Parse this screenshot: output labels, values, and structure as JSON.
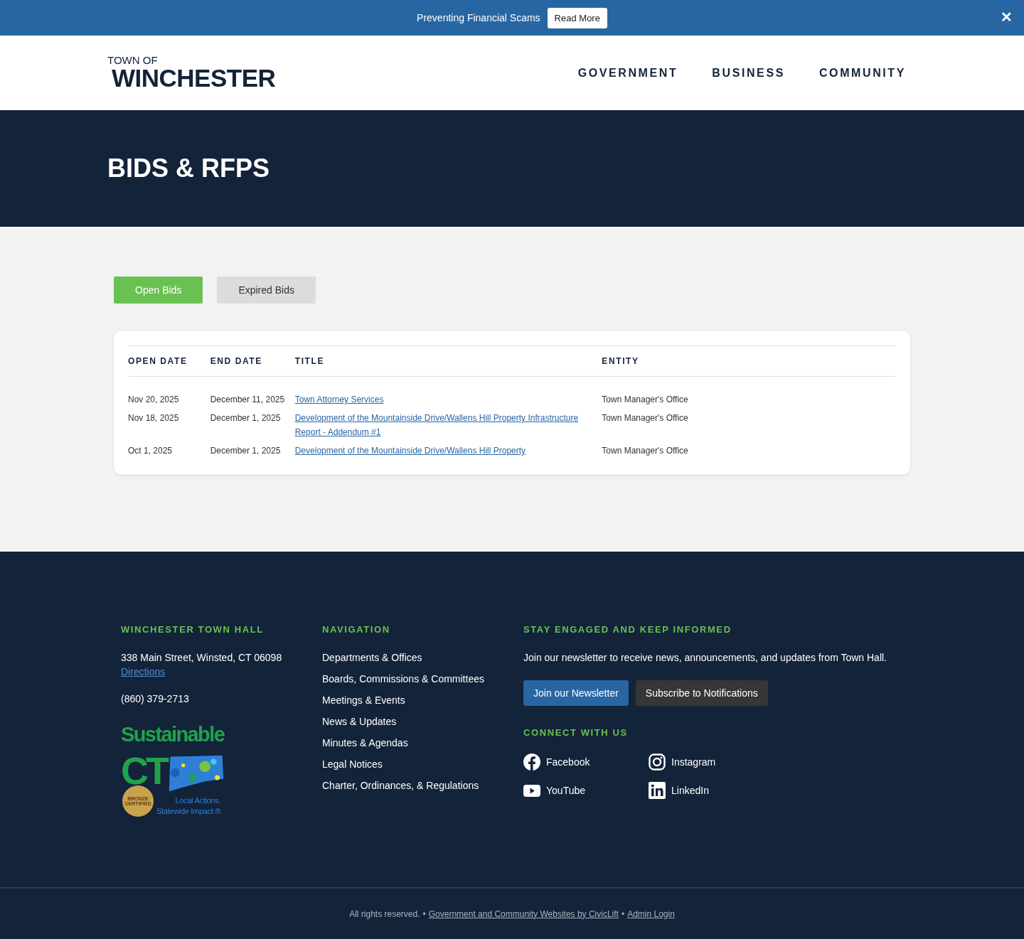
{
  "alert_bar": {
    "message": "Preventing Financial Scams",
    "button": "Read More",
    "close": "✕"
  },
  "header": {
    "logo_top": "TOWN OF",
    "logo_main": "WINCHESTER",
    "nav": [
      "GOVERNMENT",
      "BUSINESS",
      "COMMUNITY"
    ]
  },
  "hero": {
    "title": "BIDS & RFPS"
  },
  "tabs": [
    {
      "label": "Open Bids",
      "selected": true
    },
    {
      "label": "Expired Bids",
      "selected": false
    }
  ],
  "table": {
    "columns": [
      "OPEN DATE",
      "END DATE",
      "TITLE",
      "ENTITY"
    ],
    "rows": [
      {
        "open_date": "Nov 20, 2025",
        "end_date": "December 11, 2025",
        "title": "Town Attorney Services",
        "entity": "Town Manager's Office"
      },
      {
        "open_date": "Nov 18, 2025",
        "end_date": "December 1, 2025",
        "title": "Development of the Mountainside Drive/Wallens Hill Property Infrastructure Report - Addendum #1",
        "entity": "Town Manager's Office"
      },
      {
        "open_date": "Oct 1, 2025",
        "end_date": "December 1, 2025",
        "title": "Development of the Mountainside Drive/Wallens Hill Property",
        "entity": "Town Manager's Office"
      }
    ]
  },
  "footer": {
    "town_hall": {
      "heading": "WINCHESTER TOWN HALL",
      "address": "338 Main Street, Winsted, CT 06098",
      "directions": "Directions",
      "phone": "(860) 379-2713",
      "badge_logo": {
        "word1": "Sustainable",
        "word2": "CT",
        "seal_line1": "BRONZE",
        "seal_line2": "CERTIFIED",
        "tagline1": "Local Actions.",
        "tagline2": "Statewide Impact.®"
      }
    },
    "navigation": {
      "heading": "NAVIGATION",
      "links": [
        "Departments & Offices",
        "Boards, Commissions & Committees",
        "Meetings & Events",
        "News & Updates",
        "Minutes & Agendas",
        "Legal Notices",
        "Charter, Ordinances, & Regulations"
      ]
    },
    "engage": {
      "heading": "STAY ENGAGED AND KEEP INFORMED",
      "text": "Join our newsletter to receive news, announcements, and updates from Town Hall.",
      "buttons": [
        {
          "label": "Join our Newsletter",
          "kind": "primary"
        },
        {
          "label": "Subscribe to Notifications",
          "kind": "secondary"
        }
      ],
      "connect_heading": "CONNECT WITH US",
      "social": [
        {
          "label": "Facebook",
          "kind": "facebook"
        },
        {
          "label": "Instagram",
          "kind": "instagram"
        },
        {
          "label": "YouTube",
          "kind": "youtube"
        },
        {
          "label": "LinkedIn",
          "kind": "linkedin"
        }
      ]
    }
  },
  "bottom_bar": {
    "rights": "All rights reserved.",
    "sep1": "•",
    "credit": "Government and Community Websites by CivicLift",
    "sep2": "•",
    "admin": "Admin Login"
  }
}
